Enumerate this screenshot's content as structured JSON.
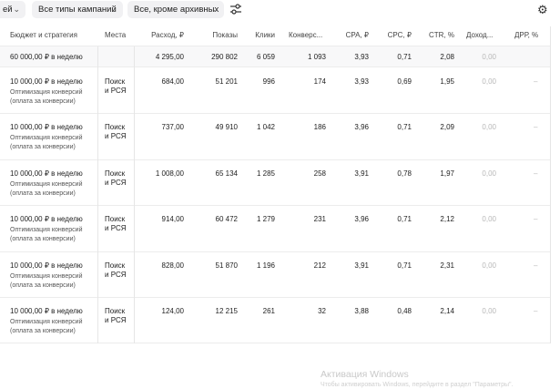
{
  "toolbar": {
    "filter1": "ей",
    "filter2": "Все типы кампаний",
    "filter3": "Все, кроме архивных"
  },
  "columns": {
    "budget": "Бюджет и стратегия",
    "places": "Места",
    "spend": "Расход, ₽",
    "impressions": "Показы",
    "clicks": "Клики",
    "conversions": "Конверс...",
    "cpa": "CPA, ₽",
    "cpc": "CPC, ₽",
    "ctr": "CTR, %",
    "income": "Доход...",
    "drr": "ДРР, %"
  },
  "total": {
    "budget": "60 000,00 ₽ в неделю",
    "spend": "4 295,00",
    "impressions": "290 802",
    "clicks": "6 059",
    "conversions": "1 093",
    "cpa": "3,93",
    "cpc": "0,71",
    "ctr": "2,08",
    "income": "0,00"
  },
  "rows": [
    {
      "budget": "10 000,00 ₽ в неделю",
      "strategy1": "Оптимизация конверсий",
      "strategy2": "(оплата за конверсии)",
      "places1": "Поиск",
      "places2": "и РСЯ",
      "spend": "684,00",
      "impressions": "51 201",
      "clicks": "996",
      "conversions": "174",
      "cpa": "3,93",
      "cpc": "0,69",
      "ctr": "1,95",
      "income": "0,00",
      "drr": "–"
    },
    {
      "budget": "10 000,00 ₽ в неделю",
      "strategy1": "Оптимизация конверсий",
      "strategy2": "(оплата за конверсии)",
      "places1": "Поиск",
      "places2": "и РСЯ",
      "spend": "737,00",
      "impressions": "49 910",
      "clicks": "1 042",
      "conversions": "186",
      "cpa": "3,96",
      "cpc": "0,71",
      "ctr": "2,09",
      "income": "0,00",
      "drr": "–"
    },
    {
      "budget": "10 000,00 ₽ в неделю",
      "strategy1": "Оптимизация конверсий",
      "strategy2": "(оплата за конверсии)",
      "places1": "Поиск",
      "places2": "и РСЯ",
      "spend": "1 008,00",
      "impressions": "65 134",
      "clicks": "1 285",
      "conversions": "258",
      "cpa": "3,91",
      "cpc": "0,78",
      "ctr": "1,97",
      "income": "0,00",
      "drr": "–"
    },
    {
      "budget": "10 000,00 ₽ в неделю",
      "strategy1": "Оптимизация конверсий",
      "strategy2": "(оплата за конверсии)",
      "places1": "Поиск",
      "places2": "и РСЯ",
      "spend": "914,00",
      "impressions": "60 472",
      "clicks": "1 279",
      "conversions": "231",
      "cpa": "3,96",
      "cpc": "0,71",
      "ctr": "2,12",
      "income": "0,00",
      "drr": "–"
    },
    {
      "budget": "10 000,00 ₽ в неделю",
      "strategy1": "Оптимизация конверсий",
      "strategy2": "(оплата за конверсии)",
      "places1": "Поиск",
      "places2": "и РСЯ",
      "spend": "828,00",
      "impressions": "51 870",
      "clicks": "1 196",
      "conversions": "212",
      "cpa": "3,91",
      "cpc": "0,71",
      "ctr": "2,31",
      "income": "0,00",
      "drr": "–"
    },
    {
      "budget": "10 000,00 ₽ в неделю",
      "strategy1": "Оптимизация конверсий",
      "strategy2": "(оплата за конверсии)",
      "places1": "Поиск",
      "places2": "и РСЯ",
      "spend": "124,00",
      "impressions": "12 215",
      "clicks": "261",
      "conversions": "32",
      "cpa": "3,88",
      "cpc": "0,48",
      "ctr": "2,14",
      "income": "0,00",
      "drr": "–"
    }
  ],
  "watermark": {
    "title": "Активация Windows",
    "subtitle": "Чтобы активировать Windows, перейдите в раздел \"Параметры\"."
  }
}
